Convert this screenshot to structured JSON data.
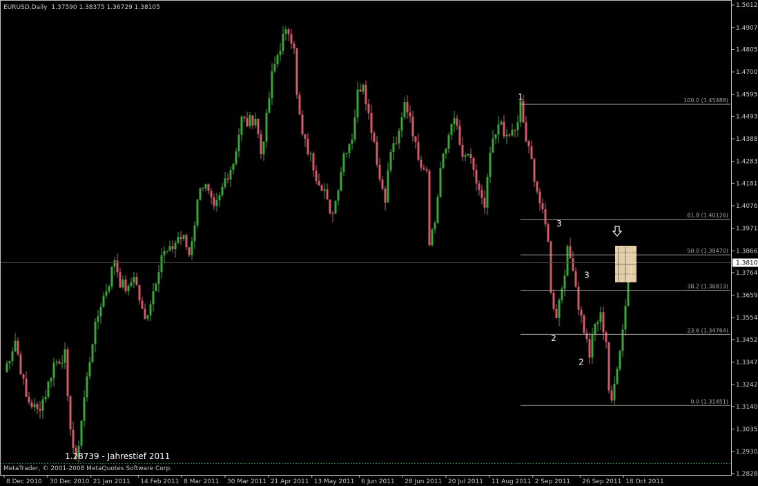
{
  "chart_header": {
    "symbol_label": "EURUSD,Daily",
    "ohlc": "1.37590 1.38375 1.36729 1.38105"
  },
  "copyright": "MetaTrader, © 2001-2008 MetaQuotes Software Corp.",
  "low_annotation": "1.28739 - Jahrestief 2011",
  "current_price_label": "1.38105",
  "colors": {
    "background": "#000000",
    "frame": "#c0c0c0",
    "bull": "#3aa63a",
    "bear": "#d25a6a",
    "fib_line": "#b4b4b4",
    "highlight_box": "#f5deb3",
    "dotted_low": "#2f7a2f"
  },
  "icons": {
    "arrow": "down-arrow-icon"
  },
  "chart_data": {
    "type": "candlestick",
    "ylim": [
      1.2821,
      1.5035
    ],
    "y_ticks": [
      "1.50120",
      "1.49070",
      "1.48050",
      "1.47000",
      "1.45950",
      "1.44930",
      "1.43880",
      "1.42830",
      "1.41810",
      "1.40760",
      "1.39710",
      "1.38660",
      "1.37640",
      "1.36590",
      "1.35540",
      "1.34520",
      "1.33470",
      "1.32420",
      "1.31400",
      "1.30350",
      "1.29300",
      "1.28280"
    ],
    "x_labels": [
      "8 Dec 2010",
      "30 Dec 2010",
      "21 Jan 2011",
      "14 Feb 2011",
      "8 Mar 2011",
      "30 Mar 2011",
      "21 Apr 2011",
      "13 May 2011",
      "6 Jun 2011",
      "28 Jun 2011",
      "20 Jul 2011",
      "11 Aug 2011",
      "2 Sep 2011",
      "26 Sep 2011",
      "18 Oct 2011"
    ],
    "x_start": "2010-12-08",
    "bar_count": 227,
    "anchors": [
      [
        0,
        1.33
      ],
      [
        4,
        1.345
      ],
      [
        8,
        1.318
      ],
      [
        12,
        1.312
      ],
      [
        15,
        1.32
      ],
      [
        18,
        1.334
      ],
      [
        22,
        1.338
      ],
      [
        23,
        1.316
      ],
      [
        25,
        1.295
      ],
      [
        26,
        1.2874
      ],
      [
        29,
        1.318
      ],
      [
        32,
        1.345
      ],
      [
        35,
        1.362
      ],
      [
        38,
        1.372
      ],
      [
        40,
        1.383
      ],
      [
        42,
        1.372
      ],
      [
        45,
        1.368
      ],
      [
        47,
        1.376
      ],
      [
        50,
        1.358
      ],
      [
        51,
        1.354
      ],
      [
        54,
        1.368
      ],
      [
        57,
        1.385
      ],
      [
        60,
        1.386
      ],
      [
        63,
        1.393
      ],
      [
        65,
        1.392
      ],
      [
        67,
        1.385
      ],
      [
        69,
        1.4
      ],
      [
        71,
        1.418
      ],
      [
        73,
        1.416
      ],
      [
        76,
        1.405
      ],
      [
        78,
        1.411
      ],
      [
        80,
        1.42
      ],
      [
        83,
        1.428
      ],
      [
        86,
        1.448
      ],
      [
        88,
        1.446
      ],
      [
        91,
        1.449
      ],
      [
        93,
        1.432
      ],
      [
        95,
        1.448
      ],
      [
        97,
        1.468
      ],
      [
        99,
        1.478
      ],
      [
        101,
        1.486
      ],
      [
        103,
        1.489
      ],
      [
        105,
        1.483
      ],
      [
        106,
        1.458
      ],
      [
        108,
        1.44
      ],
      [
        111,
        1.43
      ],
      [
        113,
        1.422
      ],
      [
        116,
        1.415
      ],
      [
        118,
        1.402
      ],
      [
        120,
        1.41
      ],
      [
        123,
        1.432
      ],
      [
        126,
        1.44
      ],
      [
        128,
        1.46
      ],
      [
        130,
        1.466
      ],
      [
        132,
        1.45
      ],
      [
        134,
        1.438
      ],
      [
        136,
        1.42
      ],
      [
        138,
        1.412
      ],
      [
        140,
        1.433
      ],
      [
        143,
        1.44
      ],
      [
        145,
        1.455
      ],
      [
        147,
        1.45
      ],
      [
        149,
        1.435
      ],
      [
        151,
        1.428
      ],
      [
        153,
        1.425
      ],
      [
        154,
        1.392
      ],
      [
        156,
        1.4
      ],
      [
        158,
        1.425
      ],
      [
        160,
        1.434
      ],
      [
        162,
        1.448
      ],
      [
        164,
        1.444
      ],
      [
        166,
        1.428
      ],
      [
        168,
        1.432
      ],
      [
        170,
        1.422
      ],
      [
        172,
        1.415
      ],
      [
        174,
        1.405
      ],
      [
        176,
        1.432
      ],
      [
        178,
        1.44
      ],
      [
        180,
        1.447
      ],
      [
        182,
        1.438
      ],
      [
        184,
        1.442
      ],
      [
        186,
        1.445
      ],
      [
        187,
        1.4549
      ],
      [
        189,
        1.438
      ],
      [
        191,
        1.428
      ],
      [
        193,
        1.415
      ],
      [
        195,
        1.403
      ],
      [
        197,
        1.393
      ],
      [
        198,
        1.366
      ],
      [
        200,
        1.357
      ],
      [
        202,
        1.37
      ],
      [
        204,
        1.386
      ],
      [
        206,
        1.38
      ],
      [
        208,
        1.361
      ],
      [
        210,
        1.35
      ],
      [
        212,
        1.338
      ],
      [
        214,
        1.352
      ],
      [
        216,
        1.356
      ],
      [
        218,
        1.345
      ],
      [
        219,
        1.322
      ],
      [
        220,
        1.3145
      ],
      [
        222,
        1.334
      ],
      [
        224,
        1.35
      ],
      [
        226,
        1.375
      ],
      [
        227,
        1.381
      ]
    ],
    "fib_levels": [
      {
        "label": "100.0 (1.45488)",
        "value": 1.45488
      },
      {
        "label": "61.8 (1.40126)",
        "value": 1.40126
      },
      {
        "label": "50.0 (1.38470)",
        "value": 1.3847
      },
      {
        "label": "38.2 (1.36813)",
        "value": 1.36813
      },
      {
        "label": "23.6 (1.34764)",
        "value": 1.34764
      },
      {
        "label": "0.0 (1.31451)",
        "value": 1.31451
      }
    ],
    "wave_labels": [
      {
        "text": "1",
        "at": 187,
        "price": 1.457
      },
      {
        "text": "3",
        "at": 201,
        "price": 1.398
      },
      {
        "text": "2",
        "at": 199,
        "price": 1.3445
      },
      {
        "text": "3",
        "at": 211,
        "price": 1.374
      },
      {
        "text": "2",
        "at": 209,
        "price": 1.3335
      }
    ],
    "current_price": 1.38105,
    "low_level": 1.28739
  }
}
